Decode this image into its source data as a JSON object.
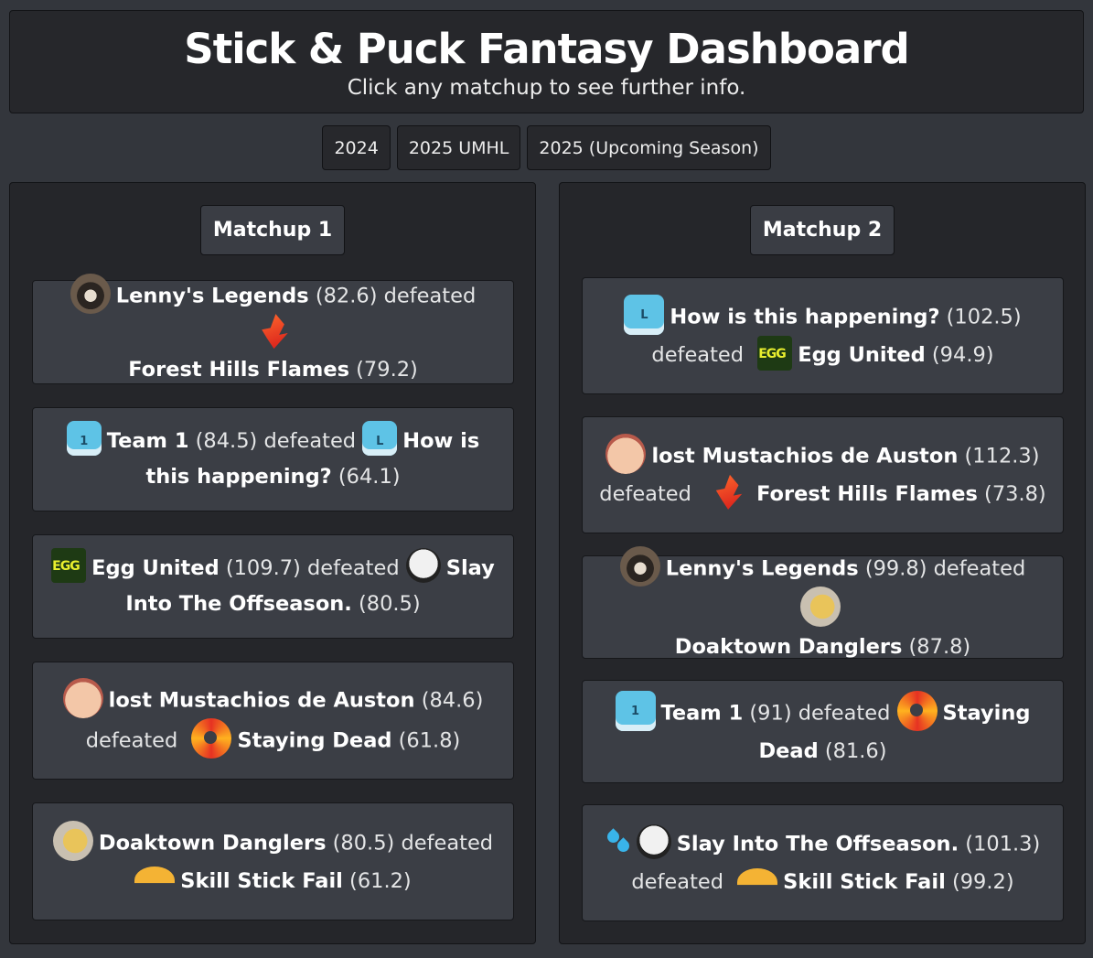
{
  "header": {
    "title": "Stick & Puck Fantasy Dashboard",
    "subtitle": "Click any matchup to see further info."
  },
  "tabs": [
    "2024",
    "2025 UMHL",
    "2025 (Upcoming Season)"
  ],
  "columns": [
    {
      "title": "Matchup 1",
      "matchups": [
        {
          "winner_icon": "raccoon-icon",
          "winner": "Lenny's Legends",
          "winner_score": "(82.6)",
          "verb": "defeated",
          "loser_icon": "flame-icon",
          "loser": "Forest Hills Flames",
          "loser_score": "(79.2)"
        },
        {
          "winner_icon": "jersey-icon",
          "winner": "Team 1",
          "winner_score": "(84.5)",
          "verb": "defeated",
          "loser_icon": "jersey-icon",
          "loser": "How is this happening?",
          "loser_score": "(64.1)"
        },
        {
          "winner_icon": "egg-logo-icon",
          "winner": "Egg United",
          "winner_score": "(109.7)",
          "verb": "defeated",
          "loser_icon": "hockey-mask-icon",
          "loser": "Slay Into The Offseason.",
          "loser_score": "(80.5)"
        },
        {
          "winner_icon": "face-icon",
          "winner": "lost Mustachios de Auston",
          "winner_score": "(84.6)",
          "verb": "defeated",
          "loser_icon": "swirl-icon",
          "loser": "Staying Dead",
          "loser_score": "(61.8)"
        },
        {
          "winner_icon": "dog-icon",
          "winner": "Doaktown Danglers",
          "winner_score": "(80.5)",
          "verb": "defeated",
          "loser_icon": "taco-icon",
          "loser": "Skill Stick Fail",
          "loser_score": "(61.2)"
        }
      ]
    },
    {
      "title": "Matchup 2",
      "matchups": [
        {
          "winner_icon": "jersey-icon",
          "winner": "How is this happening?",
          "winner_score": "(102.5)",
          "verb": "defeated",
          "loser_icon": "egg-logo-icon",
          "loser": "Egg United",
          "loser_score": "(94.9)"
        },
        {
          "winner_icon": "face-icon",
          "winner": "lost Mustachios de Auston",
          "winner_score": "(112.3)",
          "verb": "defeated",
          "loser_icon": "flame-icon",
          "loser": "Forest Hills Flames",
          "loser_score": "(73.8)"
        },
        {
          "winner_icon": "raccoon-icon",
          "winner": "Lenny's Legends",
          "winner_score": "(99.8)",
          "verb": "defeated",
          "loser_icon": "dog-icon",
          "loser": "Doaktown Danglers",
          "loser_score": "(87.8)"
        },
        {
          "winner_icon": "jersey-icon",
          "winner": "Team 1",
          "winner_score": "(91)",
          "verb": "defeated",
          "loser_icon": "swirl-icon",
          "loser": "Staying Dead",
          "loser_score": "(81.6)"
        },
        {
          "winner_icon": "hockey-mask-icon",
          "winner": "Slay Into The Offseason.",
          "winner_score": "(101.3)",
          "verb": "defeated",
          "loser_icon": "taco-icon",
          "loser": "Skill Stick Fail",
          "loser_score": "(99.2)"
        }
      ]
    }
  ]
}
